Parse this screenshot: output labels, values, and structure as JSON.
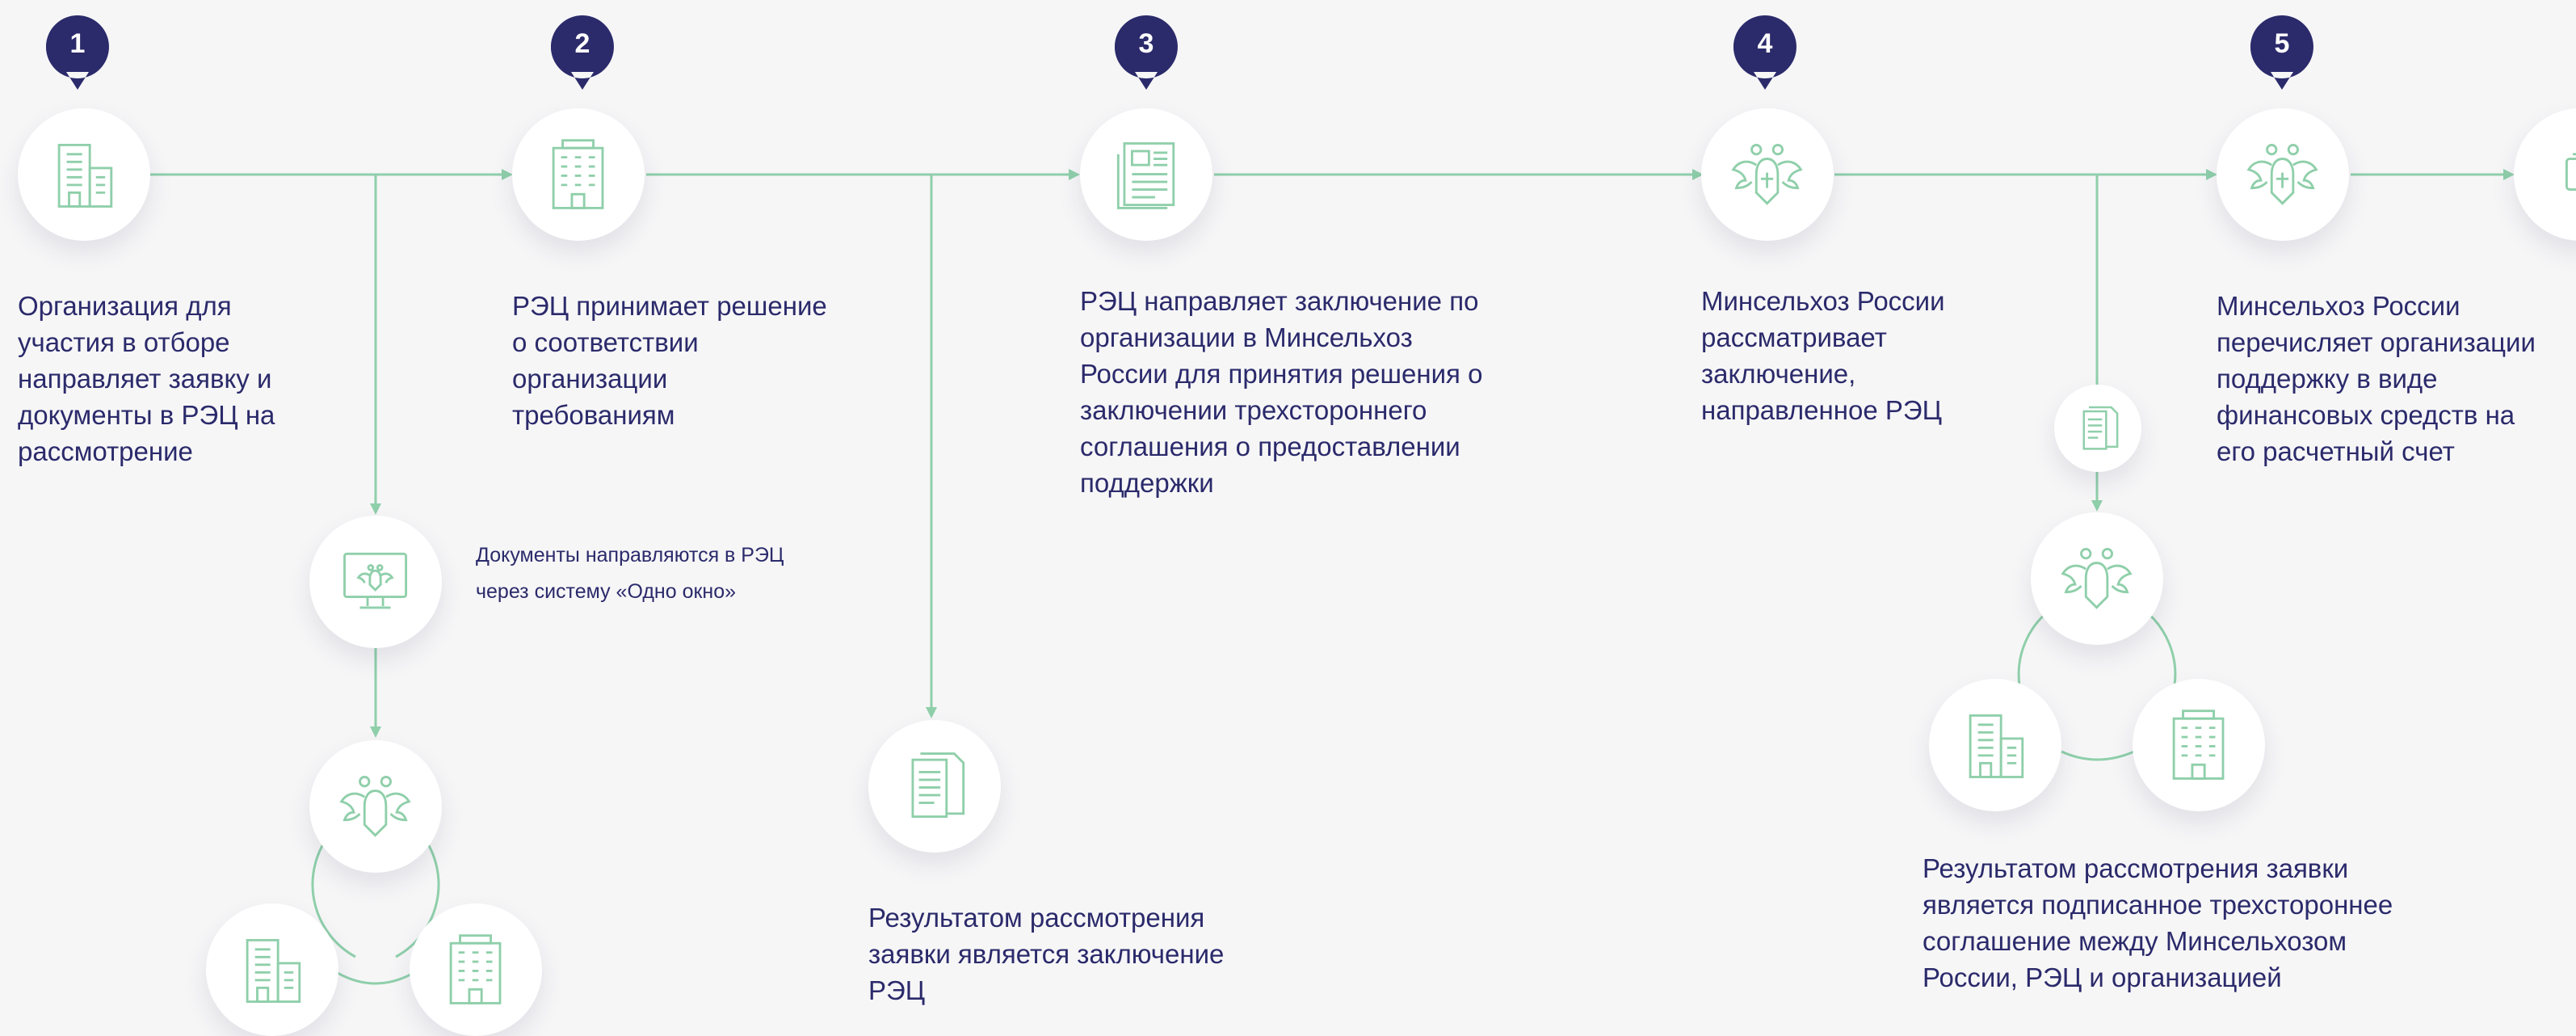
{
  "colors": {
    "accent": "#8fcfaa",
    "badge": "#2b2a6b",
    "text": "#2b2a6b",
    "background": "#f6f6f7"
  },
  "steps": [
    {
      "number": "1",
      "icon": "office-building-icon",
      "text": "Организация для\nучастия в отборе\nнаправляет заявку и\nдокументы в РЭЦ на\nрассмотрение"
    },
    {
      "number": "2",
      "icon": "tall-building-icon",
      "text": "РЭЦ принимает решение\nо соответствии\nорганизации\nтребованиям"
    },
    {
      "number": "3",
      "icon": "newspaper-icon",
      "text": "РЭЦ направляет заключение по\nорганизации в Минсельхоз\nРоссии для принятия решения о\nзаключении трехстороннего\nсоглашения о предоставлении\nподдержки"
    },
    {
      "number": "4",
      "icon": "coat-of-arms-icon",
      "text": "Минсельхоз России\nрассматривает\nзаключение,\nнаправленное РЭЦ"
    },
    {
      "number": "5",
      "icon": "coat-of-arms-icon",
      "text": "Минсельхоз России\nперечисляет организации\nподдержку в виде\nфинансовых средств на\nего расчетный счет"
    }
  ],
  "branch_notes": {
    "one_window": "Документы направляются в РЭЦ\nчерез систему «Одно окно»",
    "conclusion_result": "Результатом рассмотрения\nзаявки является заключение\nРЭЦ",
    "agreement_result": "Результатом рассмотрения заявки\nявляется подписанное трехстороннее\nсоглашение между Минсельхозом\nРоссии, РЭЦ и организацией"
  }
}
